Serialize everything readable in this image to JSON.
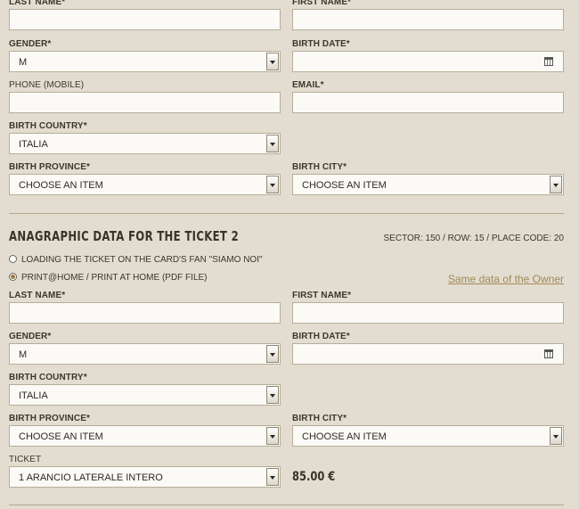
{
  "owner": {
    "last_name_label": "LAST NAME*",
    "first_name_label": "FIRST NAME*",
    "gender_label": "GENDER*",
    "gender_value": "M",
    "birth_date_label": "BIRTH DATE*",
    "phone_label": "PHONE (MOBILE)",
    "email_label": "EMAIL*",
    "birth_country_label": "BIRTH COUNTRY*",
    "birth_country_value": "ITALIA",
    "birth_province_label": "BIRTH PROVINCE*",
    "birth_province_value": "CHOOSE AN ITEM",
    "birth_city_label": "BIRTH CITY*",
    "birth_city_value": "CHOOSE AN ITEM"
  },
  "ticket2": {
    "title": "ANAGRAPHIC DATA FOR THE TICKET 2",
    "sector_info": "SECTOR: 150 / ROW: 15 / PLACE CODE: 20",
    "option_fan_card": "LOADING THE TICKET ON THE CARD'S FAN \"SIAMO NOI\"",
    "option_print_home": "PRINT@HOME / PRINT AT HOME (PDF FILE)",
    "same_data_link": "Same data of the Owner",
    "last_name_label": "LAST NAME*",
    "first_name_label": "FIRST NAME*",
    "gender_label": "GENDER*",
    "gender_value": "M",
    "birth_date_label": "BIRTH DATE*",
    "birth_country_label": "BIRTH COUNTRY*",
    "birth_country_value": "ITALIA",
    "birth_province_label": "BIRTH PROVINCE*",
    "birth_province_value": "CHOOSE AN ITEM",
    "birth_city_label": "BIRTH CITY*",
    "birth_city_value": "CHOOSE AN ITEM",
    "ticket_label": "TICKET",
    "ticket_value": "1 ARANCIO LATERALE INTERO",
    "price": "85.00 €"
  },
  "icons": {
    "calendar": "calendar-icon",
    "dropdown": "chevron-down-icon",
    "radio": "radio-button"
  }
}
